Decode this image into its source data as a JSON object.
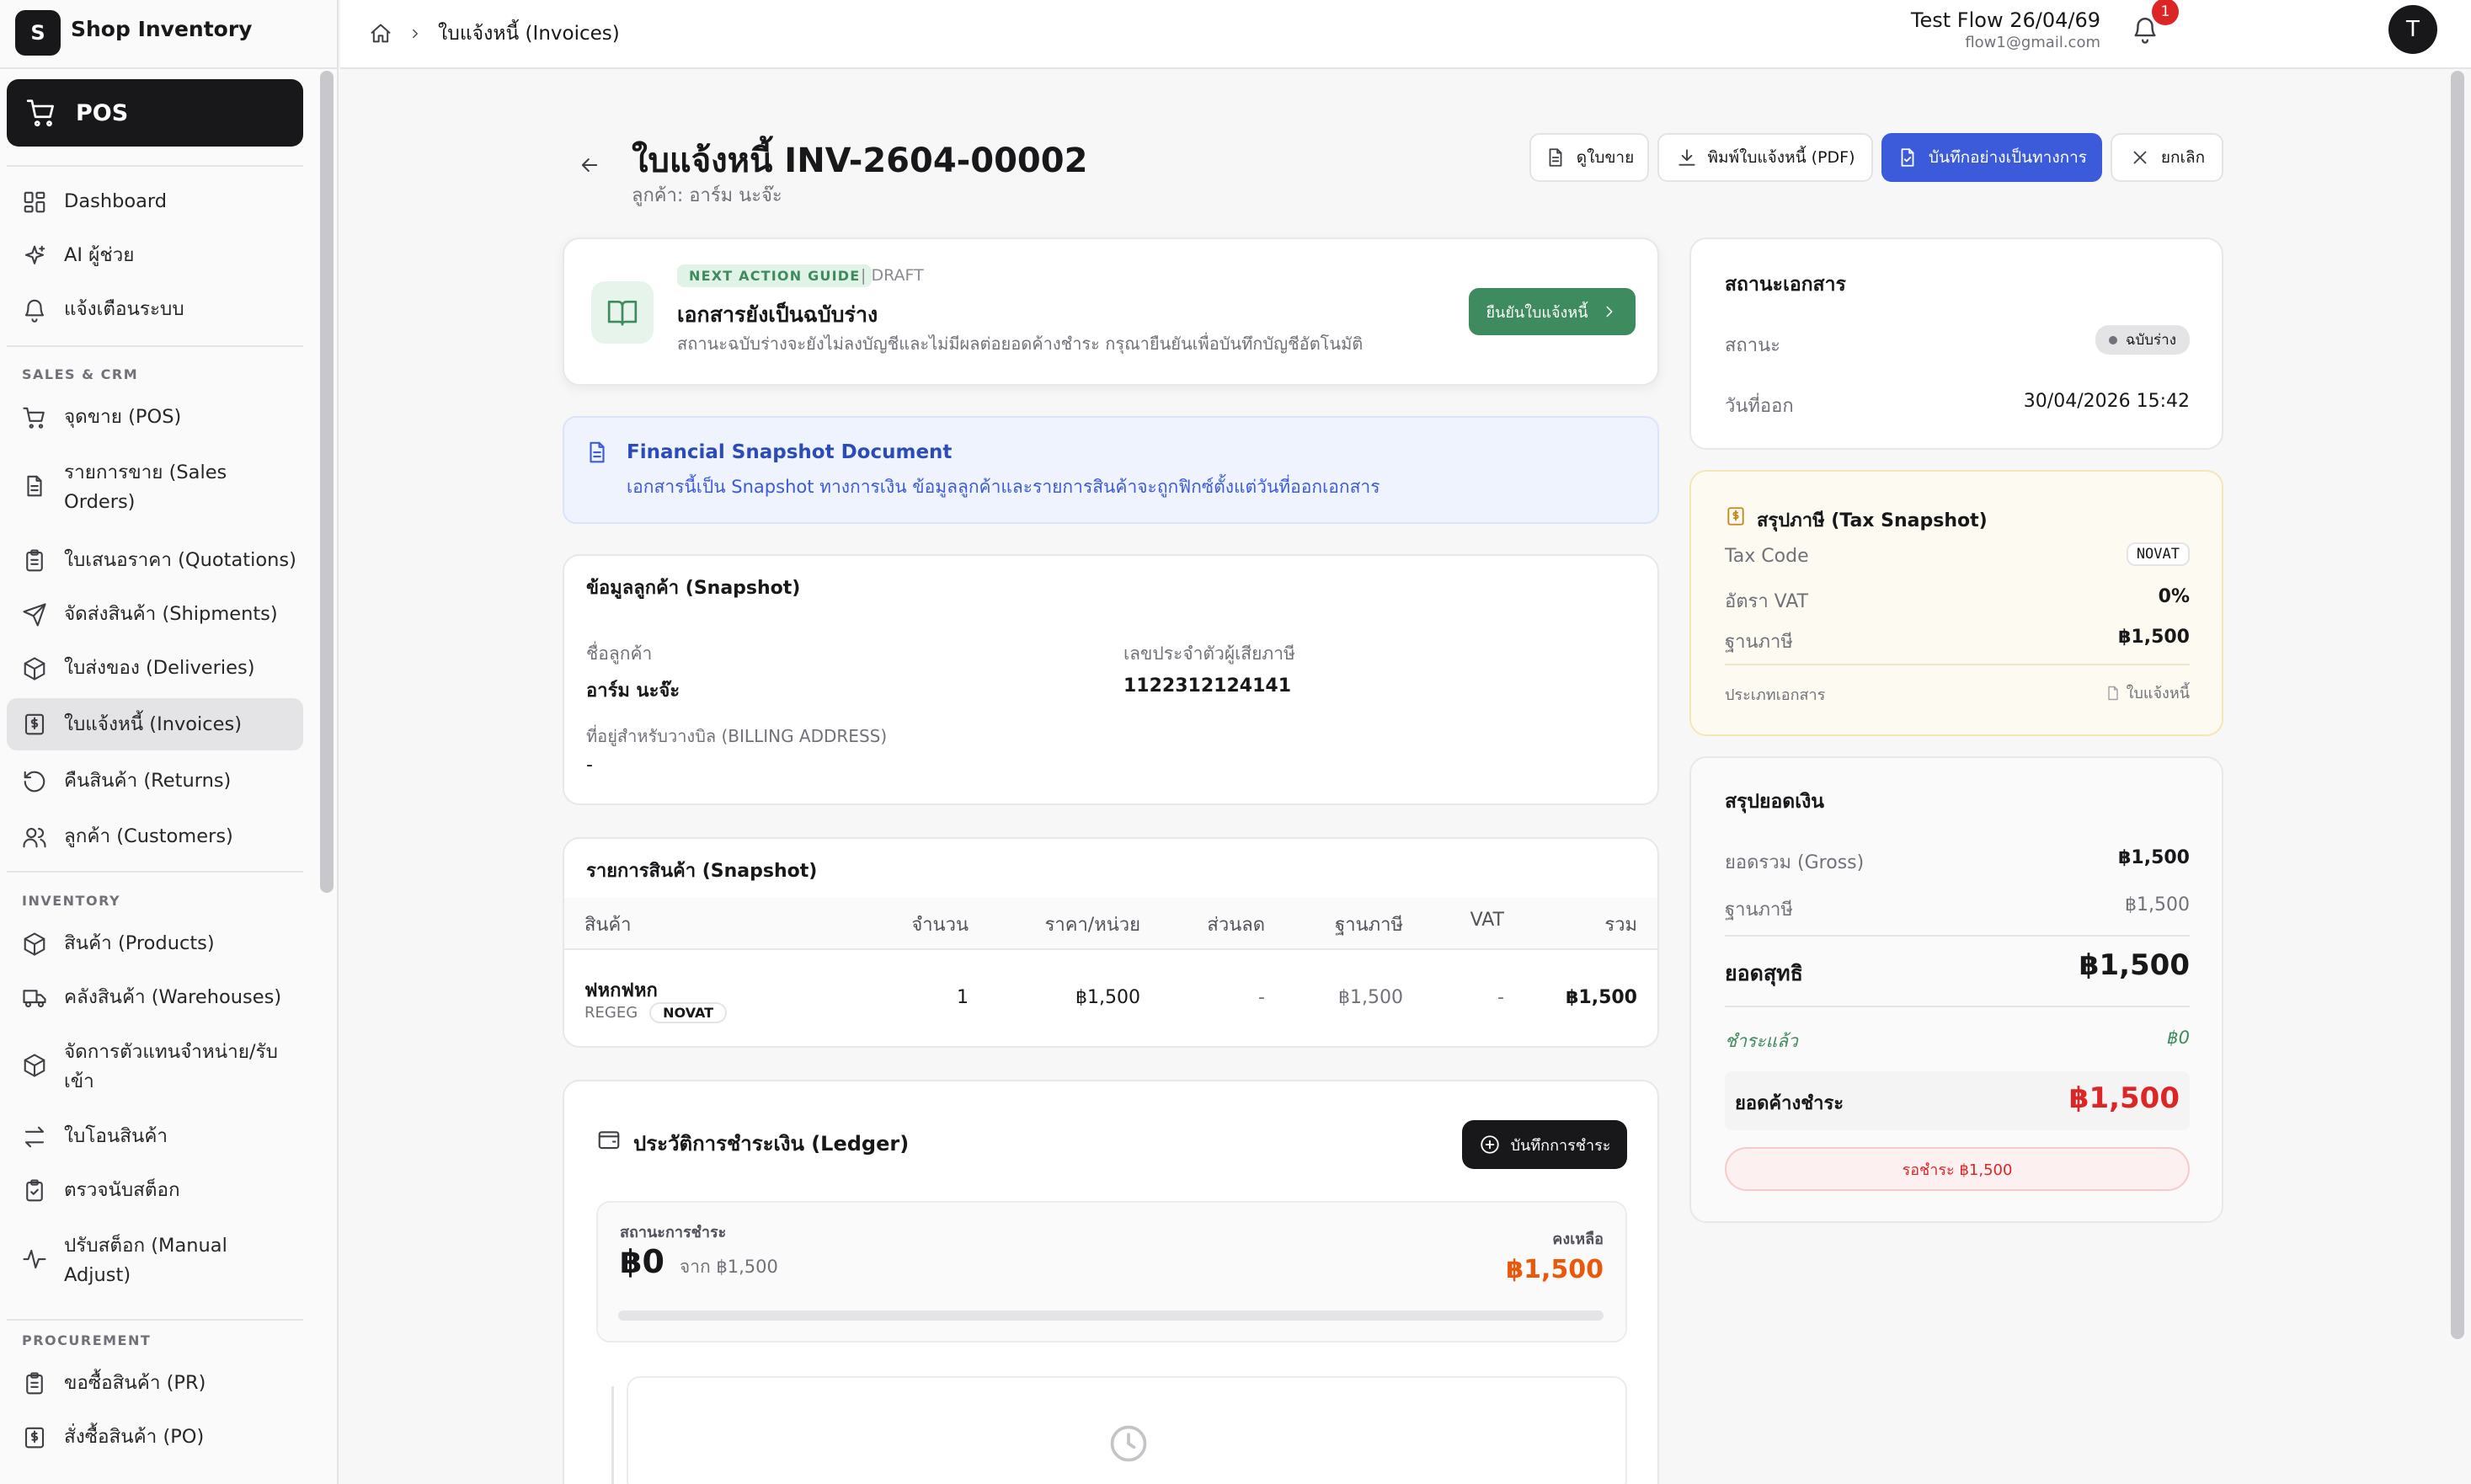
{
  "app": {
    "logo_letter": "S",
    "name": "Shop Inventory"
  },
  "sidebar": {
    "pos_label": "POS",
    "main_items": [
      {
        "label": "Dashboard",
        "icon": "dashboard-icon"
      },
      {
        "label": "AI ผู้ช่วย",
        "icon": "sparkle-icon"
      },
      {
        "label": "แจ้งเตือนระบบ",
        "icon": "bell-icon"
      }
    ],
    "sales_section": "SALES & CRM",
    "sales_items": [
      {
        "label": "จุดขาย (POS)",
        "icon": "cart-icon"
      },
      {
        "label": "รายการขาย (Sales",
        "label2": "Orders)",
        "icon": "document-icon"
      },
      {
        "label": "ใบเสนอราคา (Quotations)",
        "icon": "clipboard-icon"
      },
      {
        "label": "จัดส่งสินค้า (Shipments)",
        "icon": "send-icon"
      },
      {
        "label": "ใบส่งของ (Deliveries)",
        "icon": "package-icon"
      },
      {
        "label": "ใบแจ้งหนี้ (Invoices)",
        "icon": "invoice-icon"
      },
      {
        "label": "คืนสินค้า (Returns)",
        "icon": "return-icon"
      },
      {
        "label": "ลูกค้า (Customers)",
        "icon": "users-icon"
      }
    ],
    "inventory_section": "INVENTORY",
    "inventory_items": [
      {
        "label": "สินค้า (Products)",
        "icon": "box-icon"
      },
      {
        "label": "คลังสินค้า (Warehouses)",
        "icon": "truck-icon"
      },
      {
        "label": "จัดการตัวแทนจำหน่าย/รับ",
        "label2": "เข้า",
        "icon": "box-icon"
      },
      {
        "label": "ใบโอนสินค้า",
        "icon": "transfer-icon"
      },
      {
        "label": "ตรวจนับสต็อก",
        "icon": "clipboard-check-icon"
      },
      {
        "label": "ปรับสต็อก (Manual",
        "label2": "Adjust)",
        "icon": "activity-icon"
      }
    ],
    "procurement_section": "PROCUREMENT",
    "procurement_items": [
      {
        "label": "ขอซื้อสินค้า (PR)",
        "icon": "clipboard-list-icon"
      },
      {
        "label": "สั่งซื้อสินค้า (PO)",
        "icon": "invoice-icon"
      }
    ]
  },
  "topbar": {
    "breadcrumb": "ใบแจ้งหนี้ (Invoices)",
    "notification_count": "1",
    "user_name": "Test Flow 26/04/69",
    "user_email": "flow1@gmail.com",
    "avatar_letter": "T"
  },
  "header": {
    "title": "ใบแจ้งหนี้ INV-2604-00002",
    "subtitle": "ลูกค้า: อาร์ม นะจ๊ะ",
    "btn_view_sale": "ดูใบขาย",
    "btn_print": "พิมพ์ใบแจ้งหนี้ (PDF)",
    "btn_save_official": "บันทึกอย่างเป็นทางการ",
    "btn_cancel": "ยกเลิก"
  },
  "guide": {
    "tag": "NEXT ACTION GUIDE",
    "status": "| DRAFT",
    "title": "เอกสารยังเป็นฉบับร่าง",
    "desc": "สถานะฉบับร่างจะยังไม่ลงบัญชีและไม่มีผลต่อยอดค้างชำระ กรุณายืนยันเพื่อบันทึกบัญชีอัตโนมัติ",
    "confirm_btn": "ยืนยันใบแจ้งหนี้"
  },
  "snapshot_info": {
    "title": "Financial Snapshot Document",
    "desc": "เอกสารนี้เป็น Snapshot ทางการเงิน ข้อมูลลูกค้าและรายการสินค้าจะถูกฟิกซ์ตั้งแต่วันที่ออกเอกสาร"
  },
  "customer": {
    "section_title": "ข้อมูลลูกค้า (Snapshot)",
    "name_label": "ชื่อลูกค้า",
    "name": "อาร์ม นะจ๊ะ",
    "tax_id_label": "เลขประจำตัวผู้เสียภาษี",
    "tax_id": "1122312124141",
    "address_label": "ที่อยู่สำหรับวางบิล (BILLING ADDRESS)",
    "address": "-"
  },
  "items": {
    "section_title": "รายการสินค้า (Snapshot)",
    "columns": [
      "สินค้า",
      "จำนวน",
      "ราคา/หน่วย",
      "ส่วนลด",
      "ฐานภาษี",
      "VAT",
      "รวม"
    ],
    "rows": [
      {
        "name": "ฟหกฟหก",
        "sku": "REGEG",
        "vat_tag": "NOVAT",
        "qty": "1",
        "price": "฿1,500",
        "discount": "-",
        "tax_base": "฿1,500",
        "vat": "-",
        "total": "฿1,500"
      }
    ]
  },
  "ledger": {
    "title": "ประวัติการชำระเงิน (Ledger)",
    "record_btn": "บันทึกการชำระ",
    "status_label": "สถานะการชำระ",
    "paid": "฿0",
    "of_total": "จาก ฿1,500",
    "remaining_label": "คงเหลือ",
    "remaining": "฿1,500",
    "paid_fraction": 0
  },
  "doc_status": {
    "title": "สถานะเอกสาร",
    "status_label": "สถานะ",
    "status_value": "ฉบับร่าง",
    "issue_label": "วันที่ออก",
    "issue_value": "30/04/2026 15:42"
  },
  "tax": {
    "title": "สรุปภาษี (Tax Snapshot)",
    "code_label": "Tax Code",
    "code_value": "NOVAT",
    "rate_label": "อัตรา VAT",
    "rate_value": "0%",
    "base_label": "ฐานภาษี",
    "base_value": "฿1,500",
    "doc_type_label": "ประเภทเอกสาร",
    "doc_type_value": "ใบแจ้งหนี้"
  },
  "summary": {
    "title": "สรุปยอดเงิน",
    "gross_label": "ยอดรวม (Gross)",
    "gross_value": "฿1,500",
    "base_label": "ฐานภาษี",
    "base_value": "฿1,500",
    "net_label": "ยอดสุทธิ",
    "net_value": "฿1,500",
    "paid_label": "ชำระแล้ว",
    "paid_value": "฿0",
    "outstanding_label": "ยอดค้างชำระ",
    "outstanding_value": "฿1,500",
    "wait_pill": "รอชำระ ฿1,500"
  },
  "colors": {
    "primary": "#3b5bdb",
    "green": "#3d8b5e",
    "danger": "#dc2626",
    "orange": "#ea580c",
    "dark": "#18181b"
  }
}
